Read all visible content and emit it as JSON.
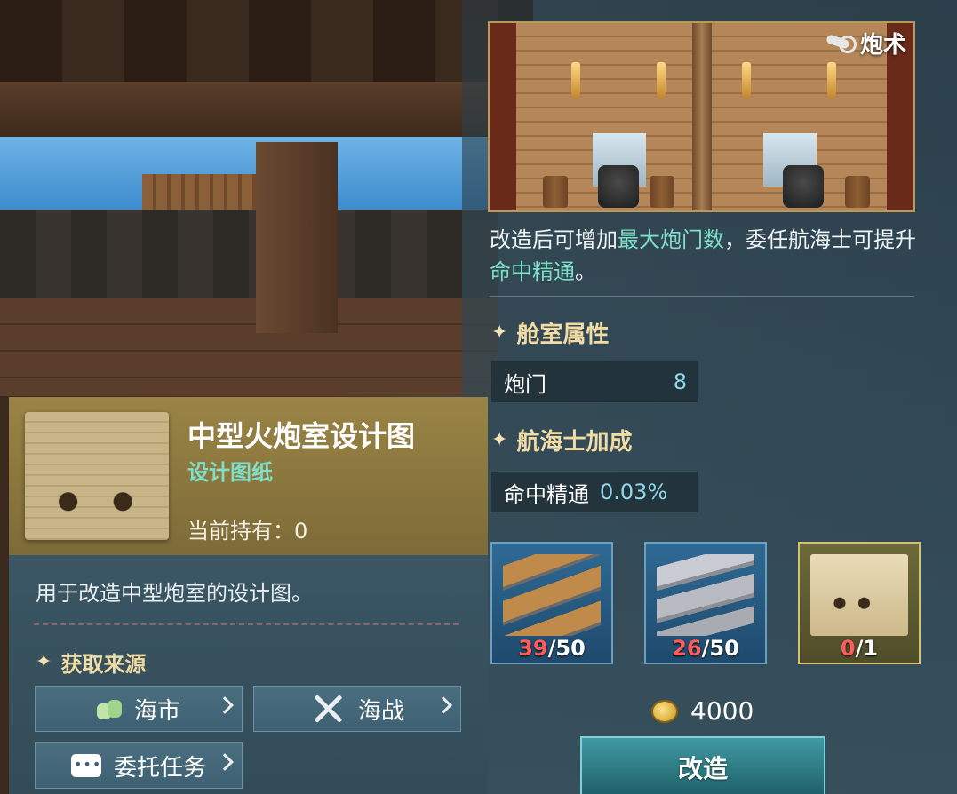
{
  "preview": {
    "tag_label": "炮术",
    "tag_icon": "cannon-icon"
  },
  "description": {
    "part1": "改造后可增加",
    "highlight1": "最大炮门数",
    "part2": "，委任航海士可提升",
    "highlight2": "命中精通",
    "part3": "。"
  },
  "cabin_attributes": {
    "title": "舱室属性",
    "rows": [
      {
        "label": "炮门",
        "value": "8"
      }
    ]
  },
  "navigator_bonus": {
    "title": "航海士加成",
    "rows": [
      {
        "label": "命中精通",
        "value": "0.03%"
      }
    ]
  },
  "materials": [
    {
      "name": "wood-planks",
      "have": "39",
      "need": "/50"
    },
    {
      "name": "iron-plates",
      "have": "26",
      "need": "/50"
    },
    {
      "name": "blueprint",
      "have": "0",
      "need": "/1"
    }
  ],
  "cost": {
    "icon": "coin-icon",
    "amount": "4000"
  },
  "action_button": "改造",
  "item_card": {
    "title": "中型火炮室设计图",
    "subtitle": "设计图纸",
    "owned_label": "当前持有：",
    "owned_value": "0",
    "description": "用于改造中型炮室的设计图。",
    "source_title": "获取来源",
    "sources": [
      {
        "label": "海市",
        "icon": "money-bag-icon"
      },
      {
        "label": "海战",
        "icon": "crossed-swords-icon"
      },
      {
        "label": "委托任务",
        "icon": "chat-bubble-icon"
      }
    ]
  },
  "colors": {
    "highlight": "#7ee0c8",
    "section_title": "#f1dca6",
    "shortage": "#ff5c5c",
    "stat_value": "#8fd8ec"
  }
}
